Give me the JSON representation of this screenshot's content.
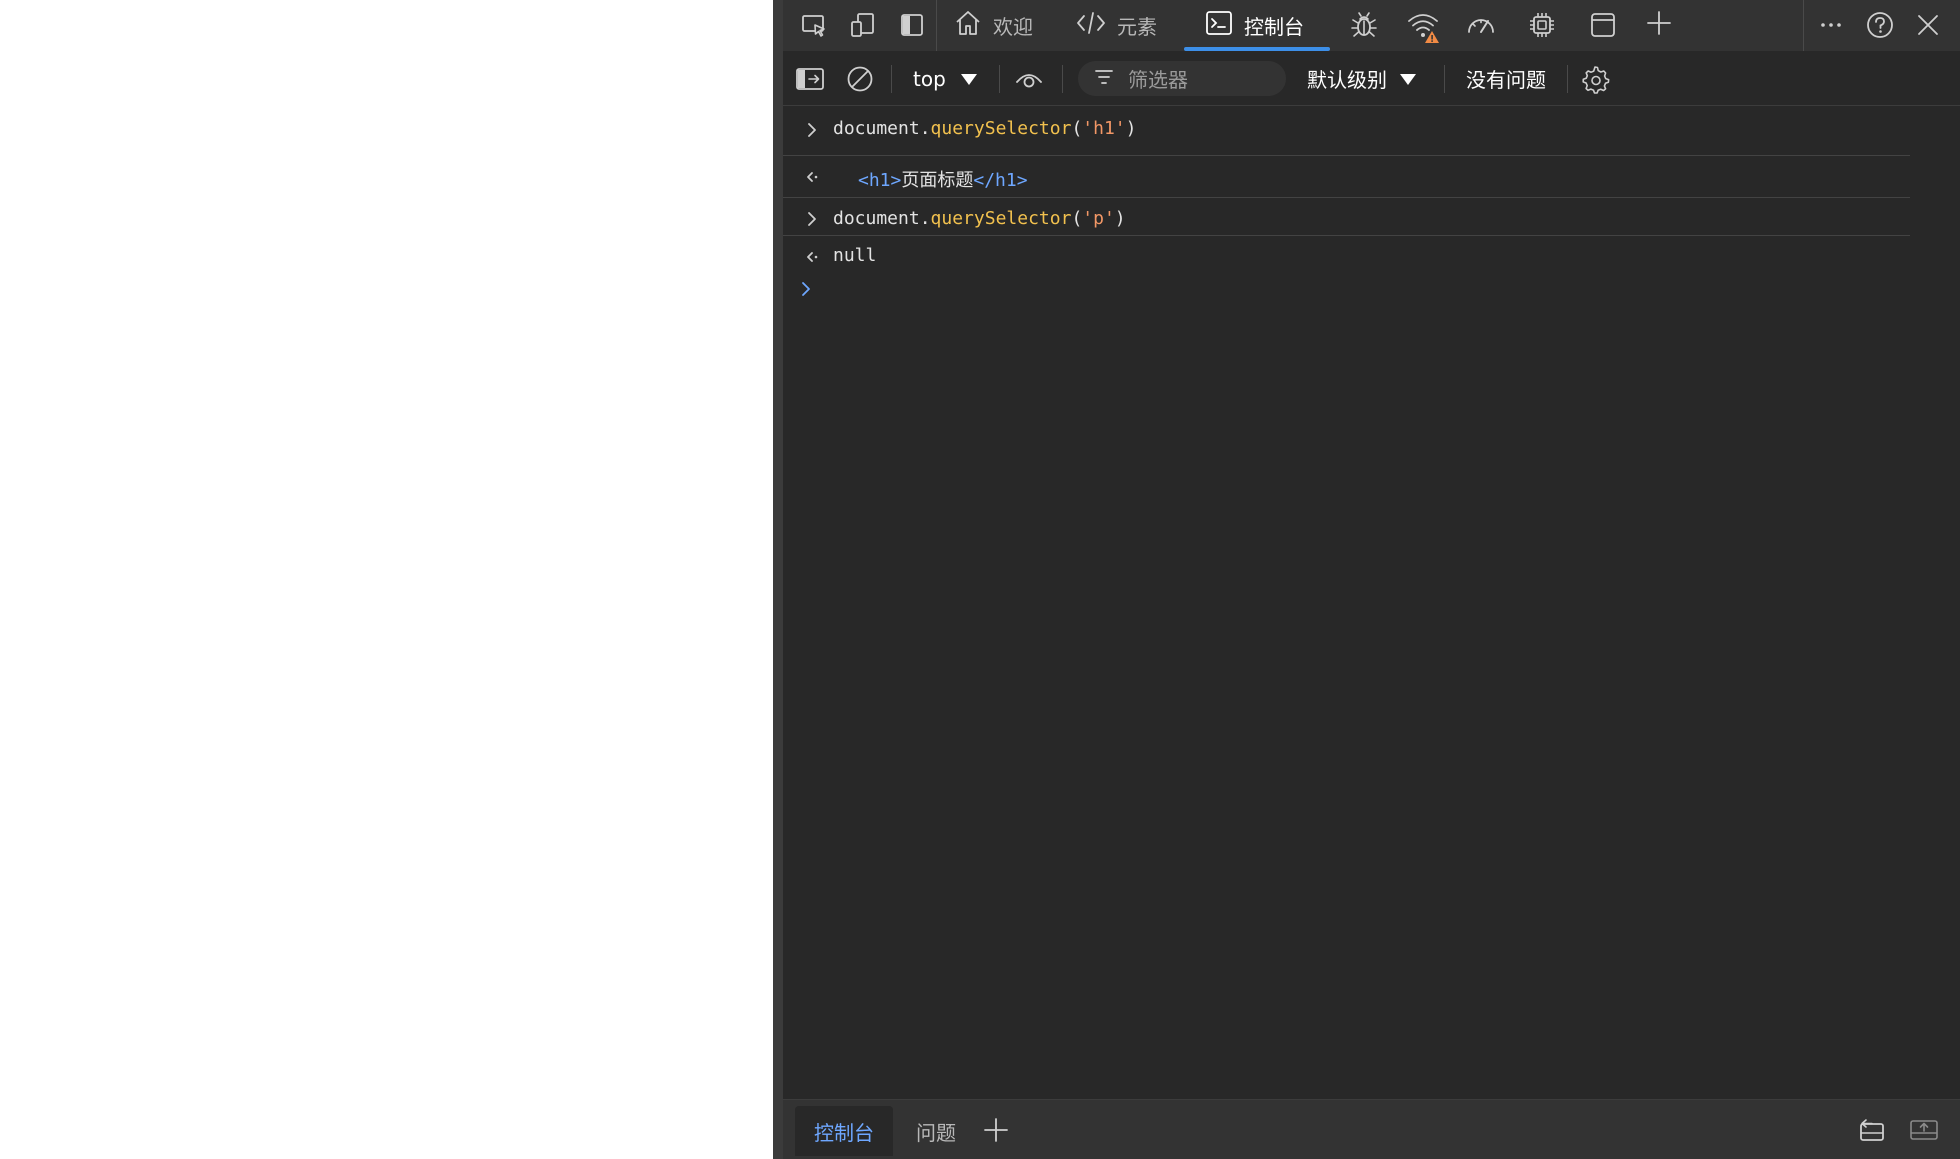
{
  "devtools": {
    "tabs": [
      {
        "label": "欢迎",
        "icon": "home-icon"
      },
      {
        "label": "元素",
        "icon": "code-brackets-icon"
      },
      {
        "label": "控制台",
        "icon": "console-icon",
        "active": true
      }
    ],
    "tool_icons": [
      "inspect-icon",
      "device-emulation-icon",
      "dock-side-icon",
      "bug-icon",
      "network-wifi-warning-icon",
      "performance-gauge-icon",
      "memory-chip-icon",
      "application-window-icon",
      "add-tool-icon",
      "more-tools-icon",
      "help-icon",
      "close-icon"
    ],
    "colors": {
      "accent": "#3d8fe8",
      "warning": "#f28b45",
      "background": "#282828",
      "tabbar": "#333333"
    }
  },
  "toolbar": {
    "context": "top",
    "filter_placeholder": "筛选器",
    "level": "默认级别",
    "issues": "没有问题"
  },
  "console": {
    "entries": [
      {
        "kind": "input",
        "object": "document",
        "dot": ".",
        "method": "querySelector",
        "open": "(",
        "arg": "'h1'",
        "close": ")"
      },
      {
        "kind": "output",
        "open_tag": "<h1>",
        "text": "页面标题",
        "close_tag": "</h1>"
      },
      {
        "kind": "input",
        "object": "document",
        "dot": ".",
        "method": "querySelector",
        "open": "(",
        "arg": "'p'",
        "close": ")"
      },
      {
        "kind": "output",
        "value": "null"
      }
    ]
  },
  "drawer": {
    "tabs": [
      {
        "label": "控制台",
        "active": true
      },
      {
        "label": "问题"
      }
    ]
  }
}
